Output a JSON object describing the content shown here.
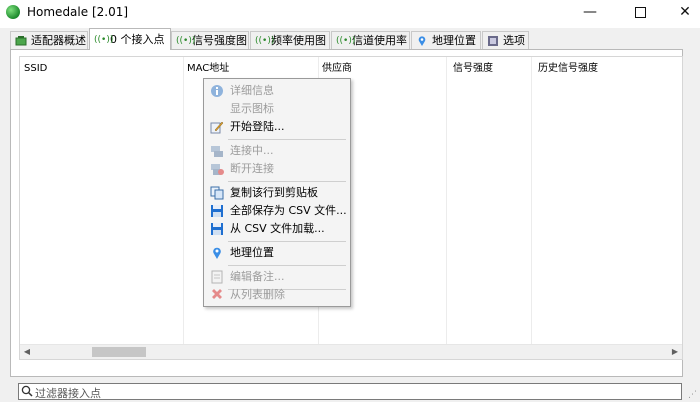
{
  "window": {
    "title": "Homedale [2.01]",
    "minimize_glyph": "—",
    "close_glyph": "✕"
  },
  "tabs": [
    {
      "label": "适配器概述",
      "icon": "adapter-icon"
    },
    {
      "label": "0 个接入点",
      "icon": "wifi-signal-icon",
      "active": true
    },
    {
      "label": "信号强度图",
      "icon": "wifi-signal-icon"
    },
    {
      "label": "频率使用图",
      "icon": "wifi-signal-icon"
    },
    {
      "label": "信道使用率",
      "icon": "wifi-signal-icon"
    },
    {
      "label": "地理位置",
      "icon": "location-pin-icon"
    },
    {
      "label": "选项",
      "icon": "options-icon"
    }
  ],
  "table": {
    "sort_glyph": "^",
    "columns": [
      "SSID",
      "MAC地址",
      "供应商",
      "信号强度",
      "历史信号强度"
    ],
    "rows": []
  },
  "scrollbar": {
    "left_glyph": "◀",
    "right_glyph": "▶"
  },
  "context_menu": {
    "items": [
      {
        "label": "详细信息",
        "icon": "info-icon",
        "enabled": false
      },
      {
        "label": "显示图标",
        "icon": "",
        "enabled": false
      },
      {
        "label": "开始登陆...",
        "icon": "notepad-pencil-icon",
        "enabled": true
      },
      {
        "label": "连接中...",
        "icon": "connect-icon",
        "enabled": false
      },
      {
        "label": "断开连接",
        "icon": "disconnect-icon",
        "enabled": false
      },
      {
        "label": "复制该行到剪贴板",
        "icon": "copy-icon",
        "enabled": true
      },
      {
        "label": "全部保存为 CSV 文件...",
        "icon": "save-icon",
        "enabled": true
      },
      {
        "label": "从 CSV 文件加载...",
        "icon": "load-icon",
        "enabled": true
      },
      {
        "label": "地理位置",
        "icon": "location-pin-icon",
        "enabled": true
      },
      {
        "label": "编辑备注...",
        "icon": "note-icon",
        "enabled": false
      },
      {
        "label": "从列表删除",
        "icon": "delete-icon",
        "enabled": false
      }
    ]
  },
  "filter": {
    "placeholder": "过滤器接入点",
    "icon": "search-icon"
  },
  "colors": {
    "window_bg": "#f0f0f0",
    "disabled_text": "#9c9c9c",
    "menu_bg": "#f4f4f4",
    "save_blue": "#1f6fd0",
    "delete_red": "#d9534f"
  }
}
